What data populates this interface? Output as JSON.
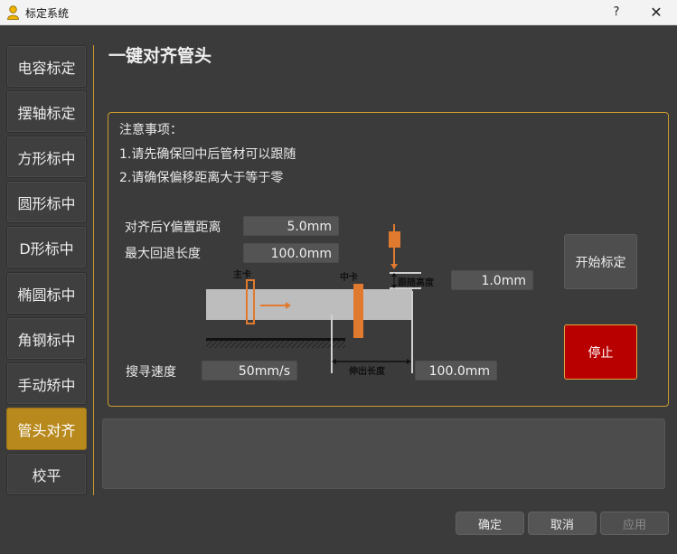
{
  "window": {
    "title": "标定系统",
    "help": "?",
    "close": "✕"
  },
  "sidebar": {
    "items": [
      {
        "label": "电容标定",
        "active": false
      },
      {
        "label": "摆轴标定",
        "active": false
      },
      {
        "label": "方形标中",
        "active": false
      },
      {
        "label": "圆形标中",
        "active": false
      },
      {
        "label": "D形标中",
        "active": false
      },
      {
        "label": "椭圆标中",
        "active": false
      },
      {
        "label": "角钢标中",
        "active": false
      },
      {
        "label": "手动矫中",
        "active": false
      },
      {
        "label": "管头对齐",
        "active": true
      },
      {
        "label": "校平",
        "active": false
      }
    ]
  },
  "page": {
    "title": "一键对齐管头",
    "notes": {
      "header": "注意事项：",
      "line1": "1.请先确保回中后管材可以跟随",
      "line2": "2.请确保偏移距离大于等于零"
    },
    "params": {
      "y_offset_label": "对齐后Y偏置距离",
      "y_offset_value": "5.0mm",
      "max_retreat_label": "最大回退长度",
      "max_retreat_value": "100.0mm",
      "follow_height_value": "1.0mm",
      "search_speed_label": "搜寻速度",
      "search_speed_value": "50mm/s",
      "extend_length_value": "100.0mm"
    },
    "diagram": {
      "main_chuck": "主卡",
      "middle_chuck": "中卡",
      "follow_height": "跟随高度",
      "extend_length": "伸出长度"
    },
    "buttons": {
      "start": "开始标定",
      "stop": "停止"
    }
  },
  "footer": {
    "ok": "确定",
    "cancel": "取消",
    "apply": "应用"
  },
  "colors": {
    "accent": "#c99a2e",
    "active_nav": "#b8891d",
    "stop": "#b80000",
    "orange": "#e07a2e"
  },
  "icons": {
    "app": "user-icon"
  }
}
